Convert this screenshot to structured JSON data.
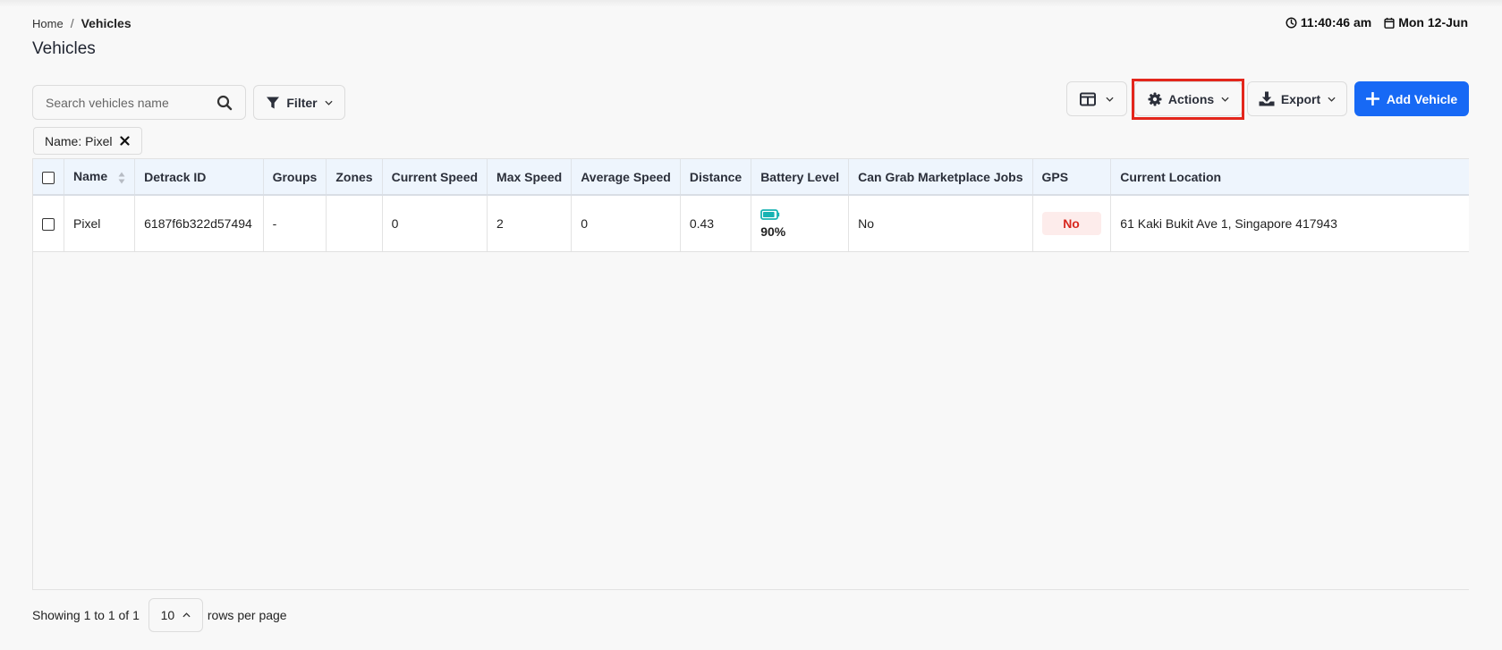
{
  "breadcrumb": {
    "home": "Home",
    "separator": "/",
    "current": "Vehicles"
  },
  "page": {
    "title": "Vehicles"
  },
  "clock": {
    "time": "11:40:46 am",
    "date": "Mon 12-Jun"
  },
  "toolbar": {
    "search_placeholder": "Search vehicles name",
    "filter_label": "Filter",
    "actions_label": "Actions",
    "export_label": "Export",
    "add_label": "Add Vehicle",
    "accent_color": "#1769f5",
    "highlight_color": "#e3261c"
  },
  "active_filters": [
    {
      "label": "Name: Pixel"
    }
  ],
  "table": {
    "headers": [
      "Name",
      "Detrack ID",
      "Groups",
      "Zones",
      "Current Speed",
      "Max Speed",
      "Average Speed",
      "Distance",
      "Battery Level",
      "Can Grab Marketplace Jobs",
      "GPS",
      "Current Location"
    ],
    "rows": [
      {
        "name": "Pixel",
        "detrack_id": "6187f6b322d57494",
        "groups": "-",
        "zones": "",
        "current_speed": "0",
        "max_speed": "2",
        "average_speed": "0",
        "distance": "0.43",
        "battery_level": "90%",
        "battery_fraction": 0.9,
        "can_grab_marketplace_jobs": "No",
        "gps": "No",
        "current_location": "61 Kaki Bukit Ave 1, Singapore 417943"
      }
    ]
  },
  "pagination": {
    "showing": "Showing 1 to 1 of 1",
    "page_size": "10",
    "rows_per_page": "rows per page"
  },
  "icons": {
    "clock": "clock-icon",
    "calendar": "calendar-icon",
    "search": "search-icon",
    "filter": "funnel-icon",
    "columns": "columns-icon",
    "actions": "gear-icon",
    "export": "download-icon",
    "add": "plus-icon",
    "remove_filter": "close-icon",
    "battery": "battery-icon"
  }
}
